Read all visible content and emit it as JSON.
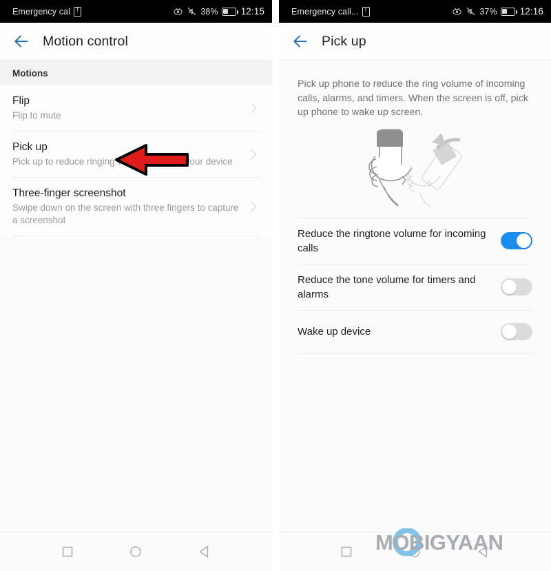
{
  "left_screen": {
    "statusbar": {
      "carrier": "Emergency cal",
      "sim_icon": "sim-card-alert-icon",
      "eyecare_icon": "eye-comfort-icon",
      "mute_icon": "ringer-silent-icon",
      "battery_percent": "38%",
      "battery_icon": "battery-icon",
      "time": "12:15"
    },
    "appbar": {
      "back_icon": "back-arrow-icon",
      "title": "Motion control"
    },
    "section_header": "Motions",
    "items": [
      {
        "title": "Flip",
        "subtitle": "Flip to mute",
        "chevron_icon": "chevron-right-icon"
      },
      {
        "title": "Pick up",
        "subtitle": "Pick up to reduce ringing volume or wake your device",
        "chevron_icon": "chevron-right-icon"
      },
      {
        "title": "Three-finger screenshot",
        "subtitle": "Swipe down on the screen with three fingers to capture a screenshot",
        "chevron_icon": "chevron-right-icon"
      }
    ],
    "annotation": {
      "type": "arrow-pointing-left",
      "color": "#e01b1b",
      "outline_color": "#000000",
      "points_at": "Pick up"
    },
    "navbar": {
      "recents_icon": "square-recents-icon",
      "home_icon": "circle-home-icon",
      "back_icon": "triangle-back-icon"
    }
  },
  "right_screen": {
    "statusbar": {
      "carrier": "Emergency call...",
      "sim_icon": "sim-card-alert-icon",
      "eyecare_icon": "eye-comfort-icon",
      "mute_icon": "ringer-silent-icon",
      "battery_percent": "37%",
      "battery_icon": "battery-icon",
      "time": "12:16"
    },
    "appbar": {
      "back_icon": "back-arrow-icon",
      "title": "Pick up"
    },
    "description": "Pick up phone to reduce the ring volume of incoming calls, alarms, and timers. When the screen is off, pick up phone to wake up screen.",
    "illustration": "hand-holding-phone-lift-gesture-illustration",
    "toggles": [
      {
        "label": "Reduce the ringtone volume for incoming calls",
        "state": "on"
      },
      {
        "label": "Reduce the tone volume for timers and alarms",
        "state": "off"
      },
      {
        "label": "Wake up device",
        "state": "off"
      }
    ],
    "navbar": {
      "recents_icon": "square-recents-icon",
      "home_icon": "circle-home-icon",
      "back_icon": "triangle-back-icon"
    },
    "watermark": {
      "text": "MOBIGYAAN",
      "accent_color": "#6cb9e8"
    }
  },
  "theme": {
    "accent_blue": "#1a8cf0",
    "appbar_arrow_blue": "#2d6fa8",
    "background": "#fbfbfb",
    "text_primary": "#1d1d1d",
    "text_secondary": "#9a9a9a",
    "divider": "#ececec"
  }
}
